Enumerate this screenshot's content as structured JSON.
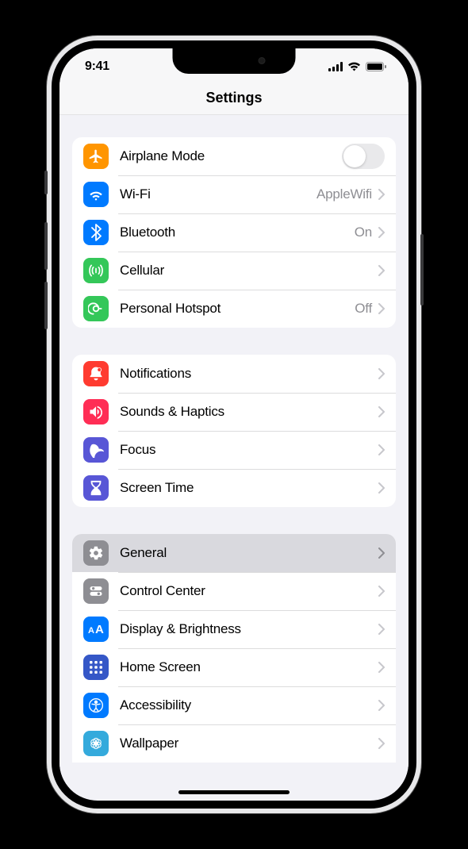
{
  "status": {
    "time": "9:41"
  },
  "header": {
    "title": "Settings"
  },
  "groups": [
    {
      "rows": [
        {
          "id": "airplane",
          "label": "Airplane Mode",
          "iconColor": "#ff9500",
          "type": "toggle",
          "value": "off"
        },
        {
          "id": "wifi",
          "label": "Wi-Fi",
          "iconColor": "#007aff",
          "type": "link",
          "value": "AppleWifi"
        },
        {
          "id": "bluetooth",
          "label": "Bluetooth",
          "iconColor": "#007aff",
          "type": "link",
          "value": "On"
        },
        {
          "id": "cellular",
          "label": "Cellular",
          "iconColor": "#34c759",
          "type": "link",
          "value": ""
        },
        {
          "id": "hotspot",
          "label": "Personal Hotspot",
          "iconColor": "#34c759",
          "type": "link",
          "value": "Off"
        }
      ]
    },
    {
      "rows": [
        {
          "id": "notifications",
          "label": "Notifications",
          "iconColor": "#ff3b30",
          "type": "link",
          "value": ""
        },
        {
          "id": "sounds",
          "label": "Sounds & Haptics",
          "iconColor": "#ff2d55",
          "type": "link",
          "value": ""
        },
        {
          "id": "focus",
          "label": "Focus",
          "iconColor": "#5856d6",
          "type": "link",
          "value": ""
        },
        {
          "id": "screentime",
          "label": "Screen Time",
          "iconColor": "#5856d6",
          "type": "link",
          "value": ""
        }
      ]
    },
    {
      "rows": [
        {
          "id": "general",
          "label": "General",
          "iconColor": "#8e8e93",
          "type": "link",
          "value": "",
          "selected": true
        },
        {
          "id": "controlcenter",
          "label": "Control Center",
          "iconColor": "#8e8e93",
          "type": "link",
          "value": ""
        },
        {
          "id": "display",
          "label": "Display & Brightness",
          "iconColor": "#007aff",
          "type": "link",
          "value": ""
        },
        {
          "id": "homescreen",
          "label": "Home Screen",
          "iconColor": "#3557c7",
          "type": "link",
          "value": ""
        },
        {
          "id": "accessibility",
          "label": "Accessibility",
          "iconColor": "#007aff",
          "type": "link",
          "value": ""
        },
        {
          "id": "wallpaper",
          "label": "Wallpaper",
          "iconColor": "#34aadc",
          "type": "link",
          "value": ""
        }
      ]
    }
  ]
}
